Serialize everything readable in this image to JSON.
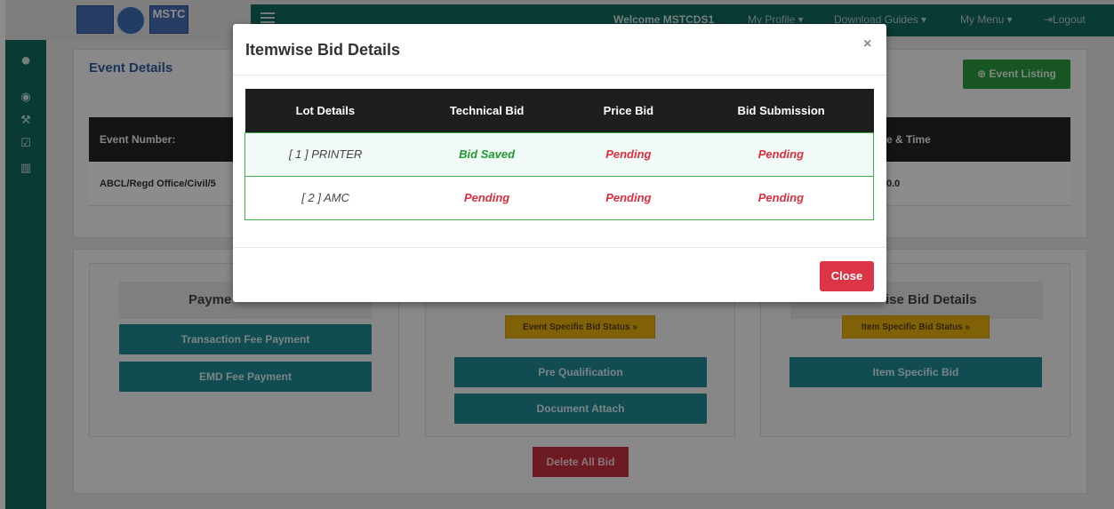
{
  "topbar": {
    "logo_text": "MSTC",
    "welcome": "Welcome MSTCDS1",
    "my_profile": "My Profile ▾",
    "download_guides": "Download Guides ▾",
    "my_menu": "My Menu ▾",
    "logout": "⇥Logout"
  },
  "page": {
    "event_details_title": "Event Details",
    "event_listing_button": "⊕ Event Listing",
    "event_table": {
      "col_event_number": "Event Number:",
      "col_date_time": "e & Time",
      "cell_event_number": "ABCL/Regd Office/Civil/5",
      "cell_date_time": "0.0"
    },
    "panels": {
      "payment_title": "Payme",
      "transaction_fee": "Transaction Fee Payment",
      "emd_fee": "EMD Fee Payment",
      "event_specific_status": "Event Specific Bid Status »",
      "pre_qualification": "Pre Qualification",
      "document_attach": "Document Attach",
      "itemwise_title": "ise Bid Details",
      "item_specific_status": "Item Specific Bid Status »",
      "item_specific_bid": "Item Specific Bid",
      "delete_all_bid": "Delete All Bid"
    }
  },
  "modal": {
    "title": "Itemwise Bid Details",
    "close_x": "×",
    "columns": [
      "Lot Details",
      "Technical Bid",
      "Price Bid",
      "Bid Submission"
    ],
    "rows": [
      {
        "lot": "[ 1 ] PRINTER",
        "technical": "Bid Saved",
        "price": "Pending",
        "submission": "Pending"
      },
      {
        "lot": "[ 2 ] AMC",
        "technical": "Pending",
        "price": "Pending",
        "submission": "Pending"
      }
    ],
    "close_button": "Close"
  },
  "colors": {
    "sidebar": "#136a5f",
    "saved": "#1f9a2e",
    "pending": "#dc2e3e",
    "close_button": "#dc3545"
  }
}
